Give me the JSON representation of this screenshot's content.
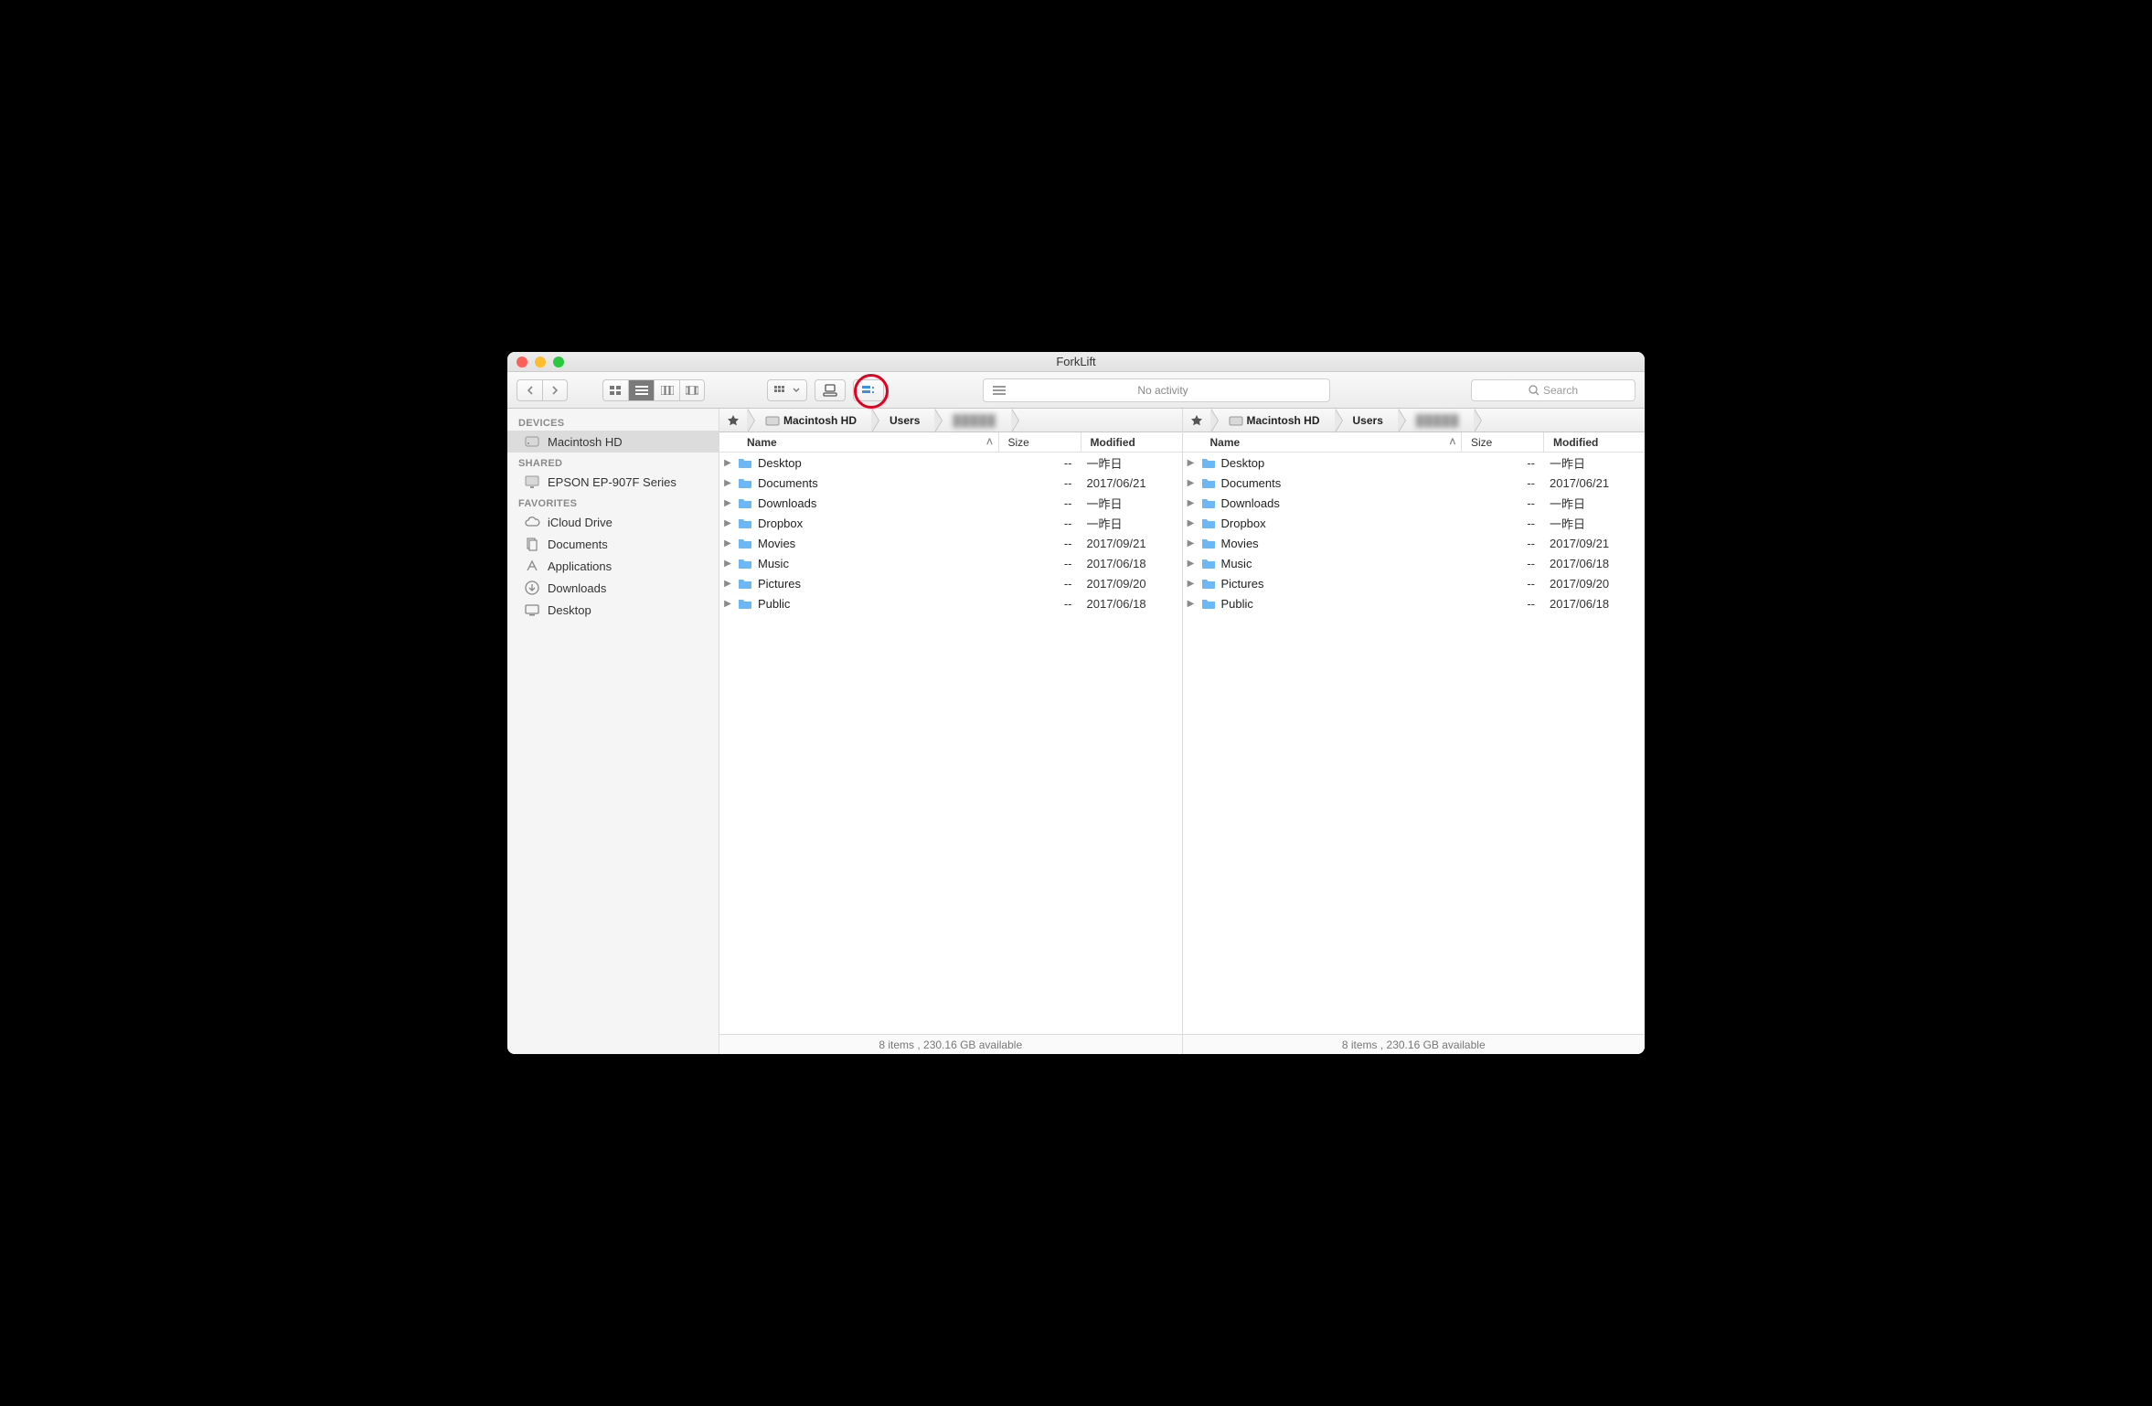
{
  "title": "ForkLift",
  "toolbar": {
    "activity_label": "No activity",
    "search_placeholder": "Search"
  },
  "sidebar": {
    "sections": [
      {
        "header": "DEVICES",
        "items": [
          {
            "icon": "hd-icon",
            "label": "Macintosh HD",
            "selected": true
          }
        ]
      },
      {
        "header": "SHARED",
        "items": [
          {
            "icon": "monitor-icon",
            "label": "EPSON EP-907F Series"
          }
        ]
      },
      {
        "header": "FAVORITES",
        "items": [
          {
            "icon": "cloud-icon",
            "label": "iCloud Drive"
          },
          {
            "icon": "documents-icon",
            "label": "Documents"
          },
          {
            "icon": "app-icon",
            "label": "Applications"
          },
          {
            "icon": "download-icon",
            "label": "Downloads"
          },
          {
            "icon": "desktop-icon",
            "label": "Desktop"
          }
        ]
      }
    ]
  },
  "panes": [
    {
      "path": [
        "Macintosh HD",
        "Users",
        "█████"
      ],
      "columns": {
        "name": "Name",
        "size": "Size",
        "modified": "Modified"
      },
      "rows": [
        {
          "name": "Desktop",
          "size": "--",
          "modified": "一昨日"
        },
        {
          "name": "Documents",
          "size": "--",
          "modified": "2017/06/21"
        },
        {
          "name": "Downloads",
          "size": "--",
          "modified": "一昨日"
        },
        {
          "name": "Dropbox",
          "size": "--",
          "modified": "一昨日"
        },
        {
          "name": "Movies",
          "size": "--",
          "modified": "2017/09/21"
        },
        {
          "name": "Music",
          "size": "--",
          "modified": "2017/06/18"
        },
        {
          "name": "Pictures",
          "size": "--",
          "modified": "2017/09/20"
        },
        {
          "name": "Public",
          "size": "--",
          "modified": "2017/06/18"
        }
      ],
      "status": "8 items , 230.16 GB available"
    },
    {
      "path": [
        "Macintosh HD",
        "Users",
        "█████"
      ],
      "columns": {
        "name": "Name",
        "size": "Size",
        "modified": "Modified"
      },
      "rows": [
        {
          "name": "Desktop",
          "size": "--",
          "modified": "一昨日"
        },
        {
          "name": "Documents",
          "size": "--",
          "modified": "2017/06/21"
        },
        {
          "name": "Downloads",
          "size": "--",
          "modified": "一昨日"
        },
        {
          "name": "Dropbox",
          "size": "--",
          "modified": "一昨日"
        },
        {
          "name": "Movies",
          "size": "--",
          "modified": "2017/09/21"
        },
        {
          "name": "Music",
          "size": "--",
          "modified": "2017/06/18"
        },
        {
          "name": "Pictures",
          "size": "--",
          "modified": "2017/09/20"
        },
        {
          "name": "Public",
          "size": "--",
          "modified": "2017/06/18"
        }
      ],
      "status": "8 items , 230.16 GB available"
    }
  ]
}
